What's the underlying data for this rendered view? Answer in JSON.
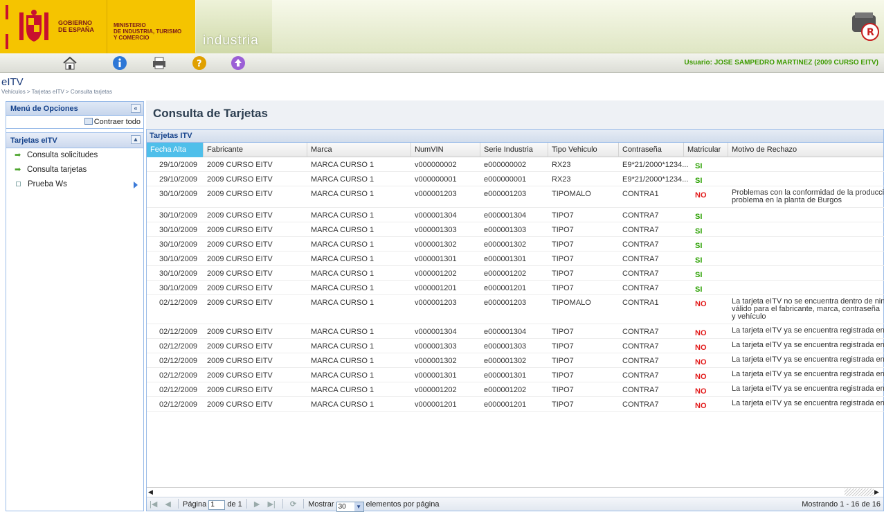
{
  "header": {
    "gov_line1": "GOBIERNO",
    "gov_line2": "DE ESPAÑA",
    "min_line1": "MINISTERIO",
    "min_line2": "DE INDUSTRIA, TURISMO",
    "min_line3": "Y COMERCIO",
    "section": "industria"
  },
  "toolbar": {
    "icons": [
      "home-icon",
      "info-icon",
      "print-icon",
      "help-icon",
      "upload-icon"
    ],
    "user": "Usuario: JOSE SAMPEDRO MARTINEZ (2009 CURSO EITV)"
  },
  "app": {
    "title": "eITV",
    "breadcrumb": "Vehículos > Tarjetas eITV > Consulta tarjetas"
  },
  "left": {
    "menu_title": "Menú de Opciones",
    "collapse_all": "Contraer todo",
    "section_title": "Tarjetas eITV",
    "items": [
      "Consulta solicitudes",
      "Consulta tarjetas",
      "Prueba Ws"
    ]
  },
  "main": {
    "title": "Consulta de Tarjetas",
    "grid_title": "Tarjetas ITV",
    "columns": [
      "Fecha Alta",
      "Fabricante",
      "Marca",
      "NumVIN",
      "Serie Industria",
      "Tipo Vehiculo",
      "Contraseña",
      "Matricular",
      "Motivo de Rechazo"
    ],
    "rows": [
      [
        "29/10/2009",
        "2009 CURSO EITV",
        "MARCA CURSO 1",
        "v000000002",
        "e000000002",
        "RX23",
        "E9*21/2000*1234...",
        "SI",
        ""
      ],
      [
        "29/10/2009",
        "2009 CURSO EITV",
        "MARCA CURSO 1",
        "v000000001",
        "e000000001",
        "RX23",
        "E9*21/2000*1234...",
        "SI",
        ""
      ],
      [
        "30/10/2009",
        "2009 CURSO EITV",
        "MARCA CURSO 1",
        "v000001203",
        "e000001203",
        "TIPOMALO",
        "CONTRA1",
        "NO",
        "Problemas con la conformidad de la producci problema en la planta de Burgos"
      ],
      [
        "30/10/2009",
        "2009 CURSO EITV",
        "MARCA CURSO 1",
        "v000001304",
        "e000001304",
        "TIPO7",
        "CONTRA7",
        "SI",
        ""
      ],
      [
        "30/10/2009",
        "2009 CURSO EITV",
        "MARCA CURSO 1",
        "v000001303",
        "e000001303",
        "TIPO7",
        "CONTRA7",
        "SI",
        ""
      ],
      [
        "30/10/2009",
        "2009 CURSO EITV",
        "MARCA CURSO 1",
        "v000001302",
        "e000001302",
        "TIPO7",
        "CONTRA7",
        "SI",
        ""
      ],
      [
        "30/10/2009",
        "2009 CURSO EITV",
        "MARCA CURSO 1",
        "v000001301",
        "e000001301",
        "TIPO7",
        "CONTRA7",
        "SI",
        ""
      ],
      [
        "30/10/2009",
        "2009 CURSO EITV",
        "MARCA CURSO 1",
        "v000001202",
        "e000001202",
        "TIPO7",
        "CONTRA7",
        "SI",
        ""
      ],
      [
        "30/10/2009",
        "2009 CURSO EITV",
        "MARCA CURSO 1",
        "v000001201",
        "e000001201",
        "TIPO7",
        "CONTRA7",
        "SI",
        ""
      ],
      [
        "02/12/2009",
        "2009 CURSO EITV",
        "MARCA CURSO 1",
        "v000001203",
        "e000001203",
        "TIPOMALO",
        "CONTRA1",
        "NO",
        "La tarjeta eITV no se encuentra dentro de nin válido para el fabricante, marca, contraseña y vehículo"
      ],
      [
        "02/12/2009",
        "2009 CURSO EITV",
        "MARCA CURSO 1",
        "v000001304",
        "e000001304",
        "TIPO7",
        "CONTRA7",
        "NO",
        "La tarjeta eITV ya se encuentra registrada en"
      ],
      [
        "02/12/2009",
        "2009 CURSO EITV",
        "MARCA CURSO 1",
        "v000001303",
        "e000001303",
        "TIPO7",
        "CONTRA7",
        "NO",
        "La tarjeta eITV ya se encuentra registrada en"
      ],
      [
        "02/12/2009",
        "2009 CURSO EITV",
        "MARCA CURSO 1",
        "v000001302",
        "e000001302",
        "TIPO7",
        "CONTRA7",
        "NO",
        "La tarjeta eITV ya se encuentra registrada en"
      ],
      [
        "02/12/2009",
        "2009 CURSO EITV",
        "MARCA CURSO 1",
        "v000001301",
        "e000001301",
        "TIPO7",
        "CONTRA7",
        "NO",
        "La tarjeta eITV ya se encuentra registrada en"
      ],
      [
        "02/12/2009",
        "2009 CURSO EITV",
        "MARCA CURSO 1",
        "v000001202",
        "e000001202",
        "TIPO7",
        "CONTRA7",
        "NO",
        "La tarjeta eITV ya se encuentra registrada en"
      ],
      [
        "02/12/2009",
        "2009 CURSO EITV",
        "MARCA CURSO 1",
        "v000001201",
        "e000001201",
        "TIPO7",
        "CONTRA7",
        "NO",
        "La tarjeta eITV ya se encuentra registrada en"
      ]
    ]
  },
  "pager": {
    "page_label": "Página",
    "page_value": "1",
    "of_label": "de 1",
    "show_label": "Mostrar",
    "page_size": "30",
    "per_page_label": "elementos por página",
    "showing": "Mostrando 1 - 16 de 16"
  },
  "colors": {
    "accent": "#15428b",
    "si": "#2aa000",
    "no": "#e21a1a",
    "sorted_header": "#4fbfea"
  }
}
